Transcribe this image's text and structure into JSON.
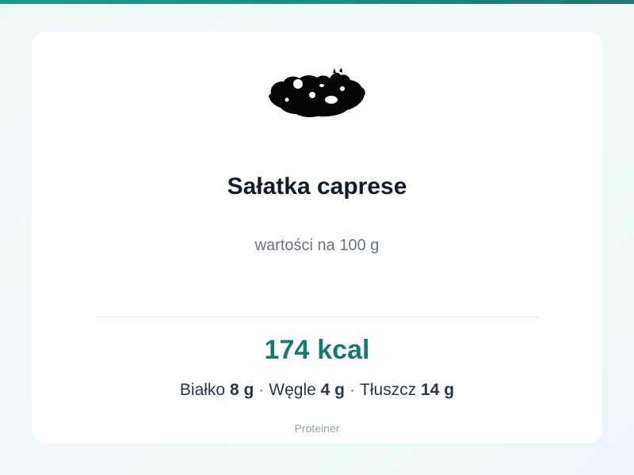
{
  "product": {
    "image_alt": "salad-photo",
    "name": "Sałatka caprese",
    "per_label": "wartości na 100 g"
  },
  "nutrition": {
    "kcal_value": "174",
    "kcal_unit": "kcal",
    "protein_label": "Białko",
    "protein_value": "8 g",
    "carbs_label": "Węgle",
    "carbs_value": "4 g",
    "fat_label": "Tłuszcz",
    "fat_value": "14 g",
    "separator": "·"
  },
  "footer": {
    "brand": "Proteiner"
  },
  "colors": {
    "accent": "#177a6d",
    "top_bar": "#1a9c8a",
    "title": "#141c2b",
    "muted": "#6b7484"
  }
}
